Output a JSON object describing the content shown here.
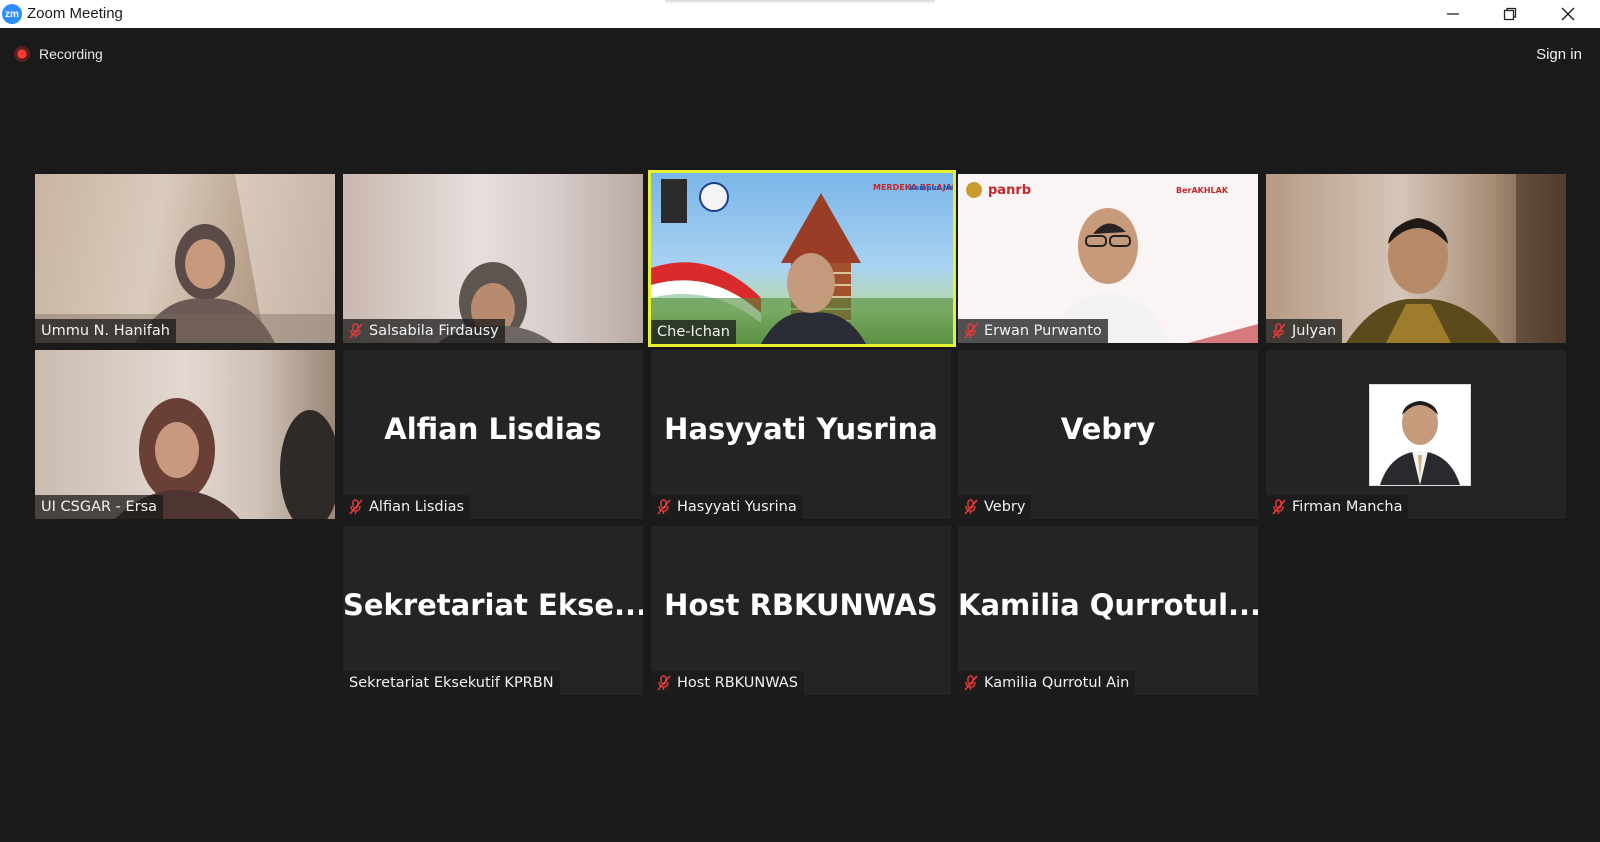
{
  "window": {
    "title": "Zoom Meeting",
    "app_icon_label": "zm"
  },
  "toolbar": {
    "recording_label": "Recording",
    "signin_label": "Sign in"
  },
  "colors": {
    "background": "#1a1a1a",
    "tile": "#242424",
    "active_speaker_border": "#e6f230",
    "recording_red": "#ff3b30",
    "mute_red": "#e23b3b"
  },
  "participants": [
    {
      "name": "Ummu N. Hanifah",
      "muted": false,
      "video": true
    },
    {
      "name": "Salsabila Firdausy",
      "muted": true,
      "video": true
    },
    {
      "name": "Che-Ichan",
      "muted": false,
      "video": true,
      "active_speaker": true
    },
    {
      "name": "Erwan Purwanto",
      "muted": true,
      "video": true
    },
    {
      "name": "Julyan",
      "muted": true,
      "video": true
    },
    {
      "name": "UI CSGAR - Ersa",
      "muted": false,
      "video": true
    },
    {
      "name": "Alfian Lisdias",
      "display": "Alfian Lisdias",
      "muted": true,
      "video": false
    },
    {
      "name": "Hasyyati Yusrina",
      "display": "Hasyyati Yusrina",
      "muted": true,
      "video": false
    },
    {
      "name": "Vebry",
      "display": "Vebry",
      "muted": true,
      "video": false
    },
    {
      "name": "Firman Mancha",
      "muted": true,
      "video": false,
      "profile_photo": true
    },
    {
      "name": "Sekretariat Eksekutif KPRBN",
      "display": "Sekretariat  Ekse...",
      "muted": false,
      "video": false
    },
    {
      "name": "Host RBKUNWAS",
      "display": "Host RBKUNWAS",
      "muted": true,
      "video": false
    },
    {
      "name": "Kamilia Qurrotul Ain",
      "display": "Kamilia  Qurrotul...",
      "muted": true,
      "video": false
    }
  ],
  "backgrounds": {
    "panrb_logo": "panrb",
    "panrb_tagline": "BerAKHLAK",
    "ui_badge_top": "MERDEKA BELAJAR",
    "ui_badge_right": "Kampus Merdeka"
  }
}
